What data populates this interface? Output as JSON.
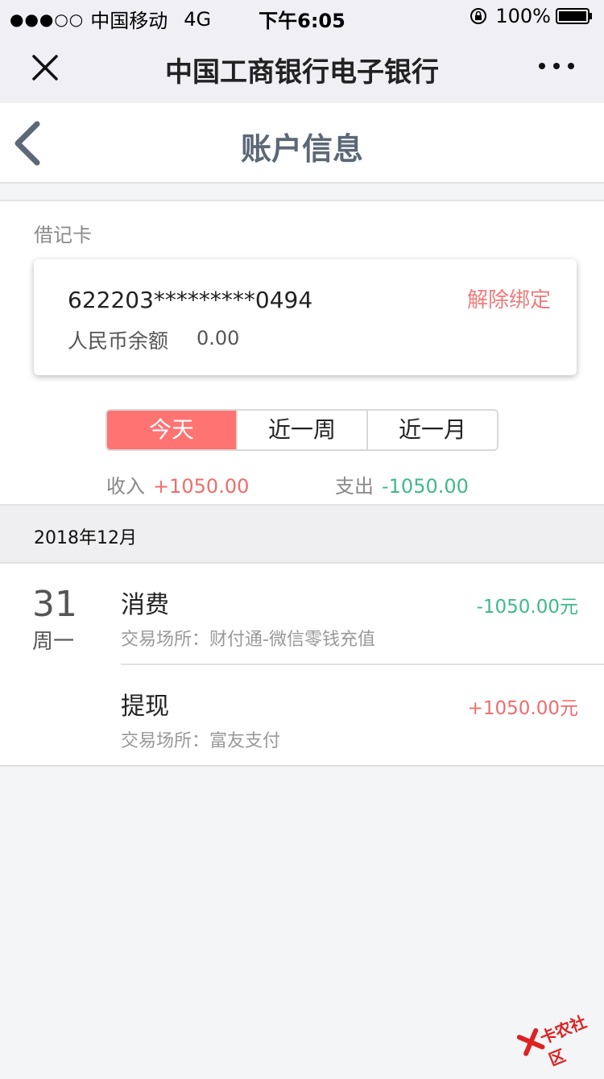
{
  "status_bar": {
    "signal": "●●●○○",
    "carrier": "中国移动",
    "network": "4G",
    "time": "下午6:05",
    "battery": "100%"
  },
  "wx_nav": {
    "title": "中国工商银行电子银行"
  },
  "page": {
    "title": "账户信息"
  },
  "card_section": {
    "label": "借记卡",
    "card_number": "622203*********0494",
    "unbind_label": "解除绑定",
    "balance_label": "人民币余额",
    "balance_value": "0.00"
  },
  "segments": [
    "今天",
    "近一周",
    "近一月"
  ],
  "summary": {
    "income_label": "收入",
    "income_value": "+1050.00",
    "expense_label": "支出",
    "expense_value": "-1050.00"
  },
  "month": "2018年12月",
  "date_group": {
    "day": "31",
    "weekday": "周一"
  },
  "transactions": [
    {
      "type": "消费",
      "place": "交易场所：财付通-微信零钱充值",
      "amount": "-1050.00元"
    },
    {
      "type": "提现",
      "place": "交易场所：富友支付",
      "amount": "+1050.00元"
    }
  ],
  "watermark": "卡农社区",
  "colors": {
    "accent": "#ff7373",
    "positive": "#f06c6c",
    "negative": "#3fb98a",
    "header_text": "#5b6877"
  }
}
